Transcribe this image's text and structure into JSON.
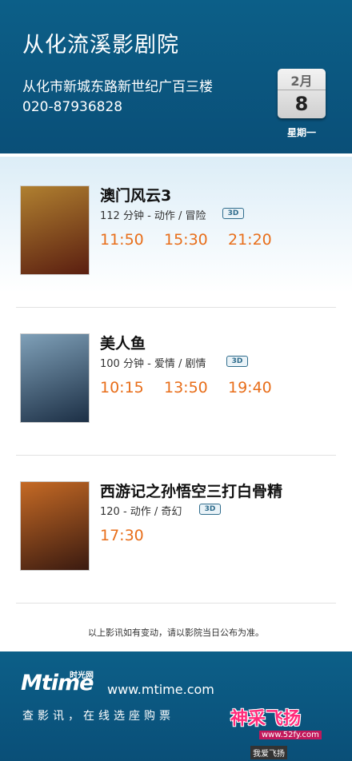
{
  "cinema": {
    "name": "从化流溪影剧院",
    "address": "从化市新城东路新世纪广百三楼",
    "phone": "020-87936828"
  },
  "date": {
    "month": "2月",
    "day": "8",
    "weekday": "星期一"
  },
  "movies": [
    {
      "title": "澳门风云3",
      "info": "112 分钟 - 动作 / 冒险",
      "format": "3D",
      "showtimes": [
        "11:50",
        "15:30",
        "21:20"
      ],
      "poster_colors": [
        "#b08030",
        "#5a1e10"
      ]
    },
    {
      "title": "美人鱼",
      "info": "100 分钟 - 爱情 / 剧情",
      "format": "3D",
      "showtimes": [
        "10:15",
        "13:50",
        "19:40"
      ],
      "poster_colors": [
        "#7fa0b8",
        "#1c2f45"
      ]
    },
    {
      "title": "西游记之孙悟空三打白骨精",
      "info": "120 - 动作 / 奇幻",
      "format": "3D",
      "showtimes": [
        "17:30"
      ],
      "poster_colors": [
        "#c56a25",
        "#3a1a10"
      ]
    }
  ],
  "notice": "以上影讯如有变动，请以影院当日公布为准。",
  "footer": {
    "logo": "Mtime",
    "logo_cn": "时光网",
    "site": "www.mtime.com",
    "slogan": "查影讯，在线选座购票",
    "watermark_main": "神采飞扬",
    "watermark_url": "www.52fy.com",
    "watermark_sub": "我爱飞扬"
  },
  "colors": {
    "header_bg": "#0a5a85",
    "showtime": "#e86e1a",
    "badge": "#2f6c8c"
  }
}
